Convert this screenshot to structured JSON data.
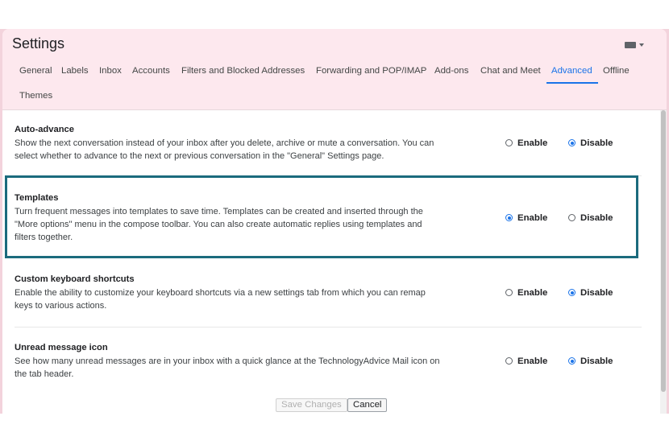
{
  "header": {
    "title": "Settings",
    "keyboard_icon": "keyboard-icon"
  },
  "tabs": [
    {
      "label": "General"
    },
    {
      "label": "Labels"
    },
    {
      "label": "Inbox"
    },
    {
      "label": "Accounts"
    },
    {
      "label": "Filters and Blocked Addresses"
    },
    {
      "label": "Forwarding and POP/IMAP"
    },
    {
      "label": "Add-ons"
    },
    {
      "label": "Chat and Meet"
    },
    {
      "label": "Advanced",
      "active": true
    },
    {
      "label": "Offline"
    },
    {
      "label": "Themes"
    }
  ],
  "sections": [
    {
      "title": "Auto-advance",
      "desc1": "Show the next conversation instead of your inbox after you delete, archive or mute a conversation. You can",
      "desc2": "select whether to advance to the next or previous conversation in the \"General\" Settings page.",
      "desc3": "",
      "enable_label": "Enable",
      "disable_label": "Disable",
      "selected": "Disable"
    },
    {
      "title": "Templates",
      "desc1": "Turn frequent messages into templates to save time. Templates can be created and inserted through the",
      "desc2": "\"More options\" menu in the compose toolbar. You can also create automatic replies using templates and",
      "desc3": "filters together.",
      "enable_label": "Enable",
      "disable_label": "Disable",
      "selected": "Enable"
    },
    {
      "title": "Custom keyboard shortcuts",
      "desc1": "Enable the ability to customize your keyboard shortcuts via a new settings tab from which you can remap",
      "desc2": "keys to various actions.",
      "desc3": "",
      "enable_label": "Enable",
      "disable_label": "Disable",
      "selected": "Disable"
    },
    {
      "title": "Unread message icon",
      "desc1": "See how many unread messages are in your inbox with a quick glance at the TechnologyAdvice Mail icon on",
      "desc2": "the tab header.",
      "desc3": "",
      "enable_label": "Enable",
      "disable_label": "Disable",
      "selected": "Disable"
    }
  ],
  "footer": {
    "save_label": "Save Changes",
    "cancel_label": "Cancel"
  },
  "colors": {
    "accent": "#1a73e8",
    "highlight_border": "#1b6b7d",
    "header_bg": "#fde8ee"
  }
}
